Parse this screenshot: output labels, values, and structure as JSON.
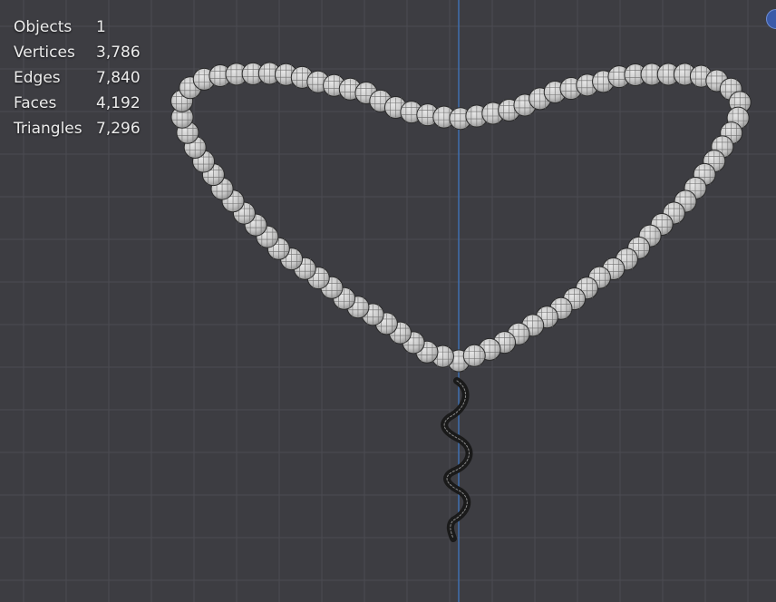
{
  "viewport": {
    "background": "#3d3d42",
    "grid_color": "#4b4b52",
    "axis_color": "#3f6fb0"
  },
  "stats": {
    "objects_label": "Objects",
    "objects_value": "1",
    "vertices_label": "Vertices",
    "vertices_value": "3,786",
    "edges_label": "Edges",
    "edges_value": "7,840",
    "faces_label": "Faces",
    "faces_value": "4,192",
    "triangles_label": "Triangles",
    "triangles_value": "7,296"
  },
  "scene": {
    "object": "bead-necklace",
    "bead_color": "#c9c9c9",
    "bead_edge_color": "#2a2a2a",
    "pendant_color": "#1a1a1a"
  },
  "gizmo": {
    "icon": "navigation-gizmo-icon",
    "color": "#3a5aa8"
  }
}
